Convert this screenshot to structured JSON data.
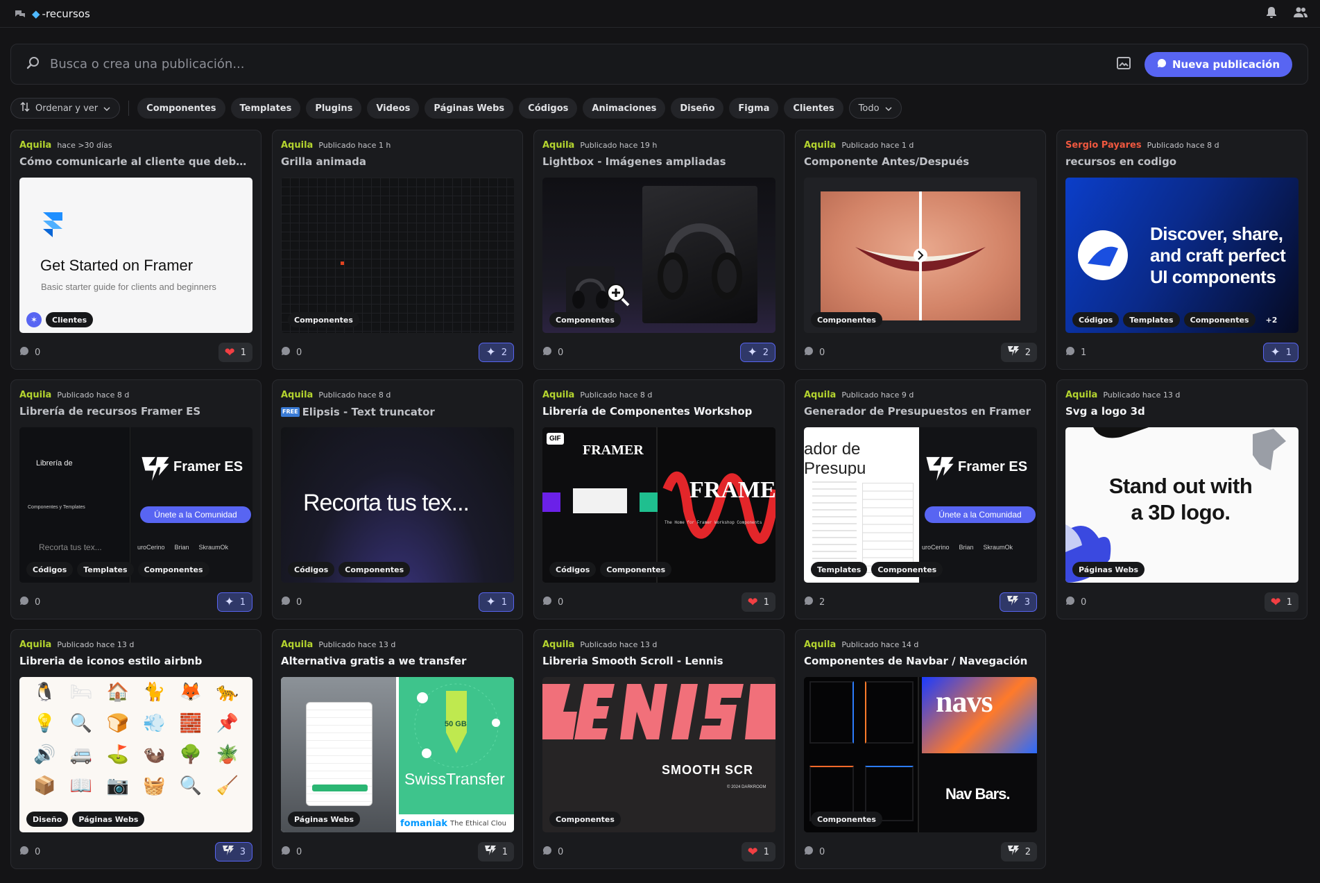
{
  "topbar": {
    "channel": "-recursos",
    "channel_icon": "gem-icon"
  },
  "search": {
    "placeholder": "Busca o crea una publicación..."
  },
  "new_post": "Nueva publicación",
  "filters": {
    "sort_label": "Ordenar y ver",
    "tags": [
      "Componentes",
      "Templates",
      "Plugins",
      "Videos",
      "Páginas Webs",
      "Códigos",
      "Animaciones",
      "Diseño",
      "Figma",
      "Clientes"
    ],
    "todo_label": "Todo"
  },
  "posts": [
    {
      "author": "Aquila",
      "time": "hace >30 días",
      "title": "Cómo comunicarle al cliente que debe adquir...",
      "tags": [
        "Clientes"
      ],
      "comments": "0",
      "reaction": "1",
      "reaction_icon": "heart-icon",
      "media": {
        "headline": "Get Started on Framer",
        "sub": "Basic starter guide for clients and beginners"
      }
    },
    {
      "author": "Aquila",
      "time": "Publicado hace 1 h",
      "title": "Grilla animada",
      "tags": [
        "Componentes"
      ],
      "comments": "0",
      "reaction": "2",
      "reaction_icon": "sparkle-icon"
    },
    {
      "author": "Aquila",
      "time": "Publicado hace 19 h",
      "title": "Lightbox - Imágenes ampliadas",
      "tags": [
        "Componentes"
      ],
      "comments": "0",
      "reaction": "2",
      "reaction_icon": "sparkle-icon"
    },
    {
      "author": "Aquila",
      "time": "Publicado hace 1 d",
      "title": "Componente Antes/Después",
      "tags": [
        "Componentes"
      ],
      "comments": "0",
      "reaction": "2",
      "reaction_icon": "framer-es-icon"
    },
    {
      "author": "Sergio Payares",
      "time": "Publicado hace 8 d",
      "title": "recursos en codigo",
      "tags": [
        "Códigos",
        "Templates",
        "Componentes",
        "+2"
      ],
      "comments": "1",
      "reaction": "1",
      "reaction_icon": "sparkle-icon",
      "media": {
        "headline": "Discover, share, and craft perfect UI components"
      }
    },
    {
      "author": "Aquila",
      "time": "Publicado hace 8 d",
      "title": "Librería de recursos Framer ES",
      "tags": [
        "Códigos",
        "Templates",
        "Componentes"
      ],
      "comments": "0",
      "reaction": "1",
      "reaction_icon": "sparkle-icon",
      "media": {
        "brand": "Framer ES",
        "cta": "Únete a la Comunidad",
        "left_title": "Librería de",
        "left_sub": "Componentes y Templates",
        "left_demo": "Recorta tus tex...",
        "users": [
          "uroCerino",
          "Brian",
          "SkraumOk"
        ]
      }
    },
    {
      "author": "Aquila",
      "time": "Publicado hace 8 d",
      "title": "Elipsis - Text truncator",
      "badge": "FREE",
      "tags": [
        "Códigos",
        "Componentes"
      ],
      "comments": "0",
      "reaction": "1",
      "reaction_icon": "sparkle-icon",
      "media": {
        "headline": "Recorta tus tex..."
      }
    },
    {
      "author": "Aquila",
      "time": "Publicado hace 8 d",
      "title": "Librería de Componentes Workshop",
      "tags": [
        "Códigos",
        "Componentes"
      ],
      "comments": "0",
      "reaction": "1",
      "reaction_icon": "heart-icon",
      "media": {
        "gif": "GIF",
        "left_logo": "FRAMER",
        "right_logo": "FRAME",
        "small": "The Home for Framer Workshop Components"
      }
    },
    {
      "author": "Aquila",
      "time": "Publicado hace 9 d",
      "title": "Generador de Presupuestos en Framer",
      "tags": [
        "Templates",
        "Componentes"
      ],
      "comments": "2",
      "reaction": "3",
      "reaction_icon": "framer-es-icon",
      "media": {
        "left_title": "ador de Presupu",
        "brand": "Framer ES",
        "cta": "Únete a la Comunidad",
        "users": [
          "uroCerino",
          "Brian",
          "SkraumOk"
        ]
      }
    },
    {
      "author": "Aquila",
      "time": "Publicado hace 13 d",
      "title": "Svg a logo 3d",
      "tags": [
        "Páginas Webs"
      ],
      "comments": "0",
      "reaction": "1",
      "reaction_icon": "heart-icon",
      "media": {
        "headline": "Stand out with a 3D logo."
      }
    },
    {
      "author": "Aquila",
      "time": "Publicado hace 13 d",
      "title": "Libreria de iconos estilo airbnb",
      "tags": [
        "Diseño",
        "Páginas Webs"
      ],
      "comments": "0",
      "reaction": "3",
      "reaction_icon": "framer-es-icon"
    },
    {
      "author": "Aquila",
      "time": "Publicado hace 13 d",
      "title": "Alternativa gratis a we transfer",
      "tags": [
        "Páginas Webs"
      ],
      "comments": "0",
      "reaction": "1",
      "reaction_icon": "framer-es-icon",
      "media": {
        "size": "50 GB",
        "brand": "SwissTransfer",
        "footer": "fomaniak",
        "footer2": "The Ethical Clou"
      }
    },
    {
      "author": "Aquila",
      "time": "Publicado hace 13 d",
      "title": "Libreria Smooth Scroll - Lennis",
      "tags": [
        "Componentes"
      ],
      "comments": "0",
      "reaction": "1",
      "reaction_icon": "heart-icon",
      "media": {
        "headline": "SMOOTH SCR",
        "credit": "© 2024 DARKROOM"
      }
    },
    {
      "author": "Aquila",
      "time": "Publicado hace 14 d",
      "title": "Componentes de Navbar / Navegación",
      "tags": [
        "Componentes"
      ],
      "comments": "0",
      "reaction": "2",
      "reaction_icon": "framer-es-icon",
      "media": {
        "top": "navs",
        "bottom": "Nav Bars."
      }
    }
  ],
  "colors": {
    "accent": "#5865f2",
    "author": "#b4d42f",
    "author_alt": "#f0583f",
    "bg": "#141416",
    "card": "#1a1b1e"
  }
}
